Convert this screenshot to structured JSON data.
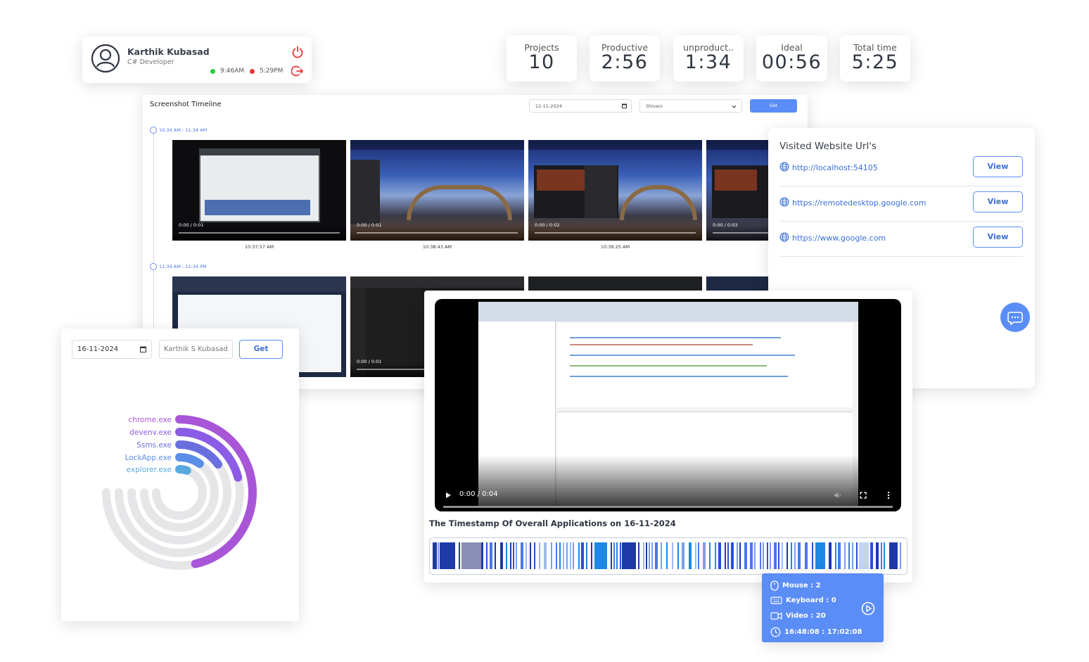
{
  "profile": {
    "name": "Karthik Kubasad",
    "role": "C# Developer",
    "login_time": "9:46AM",
    "logout_time": "5:29PM",
    "colors": {
      "online": "#2ecc40",
      "offline": "#e53935",
      "icon": "#e53935"
    }
  },
  "stats": [
    {
      "label": "Projects",
      "value": "10"
    },
    {
      "label": "Productive",
      "value": "2:56"
    },
    {
      "label": "unproduct..",
      "value": "1:34"
    },
    {
      "label": "Ideal",
      "value": "00:56"
    },
    {
      "label": "Total time",
      "value": "5:25"
    }
  ],
  "timeline": {
    "title": "Screenshot Timeline",
    "date": "12-11-2024",
    "user": "Shivani",
    "get_label": "Get",
    "groups": [
      {
        "range": "10:34 AM - 11:34 AM",
        "shots": [
          {
            "video_time": "0:00 / 0:01",
            "timestamp": "10:37:57 AM"
          },
          {
            "video_time": "0:00 / 0:01",
            "timestamp": "10:38:43 AM"
          },
          {
            "video_time": "0:00 / 0:02",
            "timestamp": "10:39:25 AM"
          },
          {
            "video_time": "0:00 / 0:03",
            "timestamp": ""
          }
        ]
      },
      {
        "range": "11:34 AM - 12:34 PM",
        "shots": [
          {
            "video_time": "",
            "timestamp": ""
          },
          {
            "video_time": "0:00 / 0:01",
            "timestamp": ""
          },
          {
            "video_time": "",
            "timestamp": ""
          },
          {
            "video_time": "",
            "timestamp": ""
          }
        ]
      }
    ]
  },
  "visited": {
    "title": "Visited Website Url's",
    "urls": [
      {
        "url": "http://localhost:54105",
        "button": "View"
      },
      {
        "url": "https://remotedesktop.google.com",
        "button": "View"
      },
      {
        "url": "https://www.google.com",
        "button": "View"
      }
    ]
  },
  "apps": {
    "date": "16-11-2024",
    "user": "Karthik S Kubasad",
    "get_label": "Get",
    "items": [
      {
        "name": "chrome.exe",
        "color": "#a855d8",
        "fraction": 0.62
      },
      {
        "name": "devenv.exe",
        "color": "#8b5ce6",
        "fraction": 0.28
      },
      {
        "name": "Ssms.exe",
        "color": "#6a6fe0",
        "fraction": 0.2
      },
      {
        "name": "LockApp.exe",
        "color": "#5a8ee8",
        "fraction": 0.13
      },
      {
        "name": "explorer.exe",
        "color": "#59a9e0",
        "fraction": 0.07
      }
    ]
  },
  "video": {
    "time": "0:00 / 0:04",
    "title": "The Timestamp Of Overall Applications on 16-11-2024"
  },
  "tooltip": {
    "mouse": "Mouse : 2",
    "keyboard": "Keyboard : 0",
    "video": "Video : 20",
    "range": "16:48:08 : 17:02:08"
  }
}
